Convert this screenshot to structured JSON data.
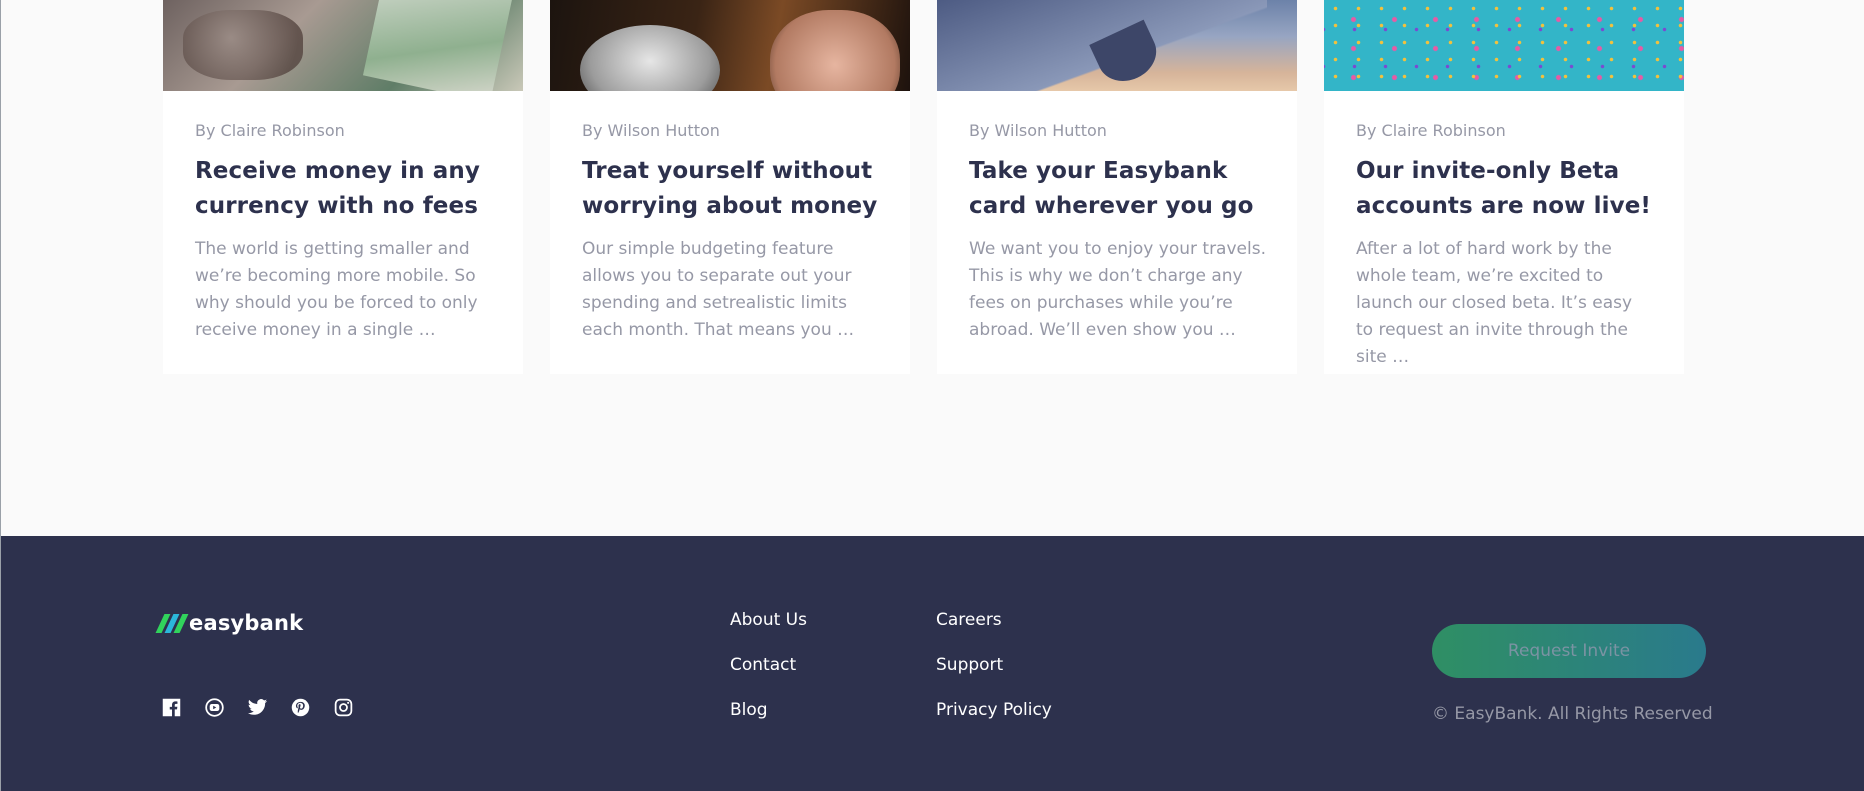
{
  "articles": [
    {
      "author": "By Claire Robinson",
      "title": "Receive money in any currency with no fees",
      "excerpt": "The world is getting smaller and we’re becoming more mobile. So why should you be forced to only receive money in a single …",
      "image": "currency-notes"
    },
    {
      "author": "By Wilson Hutton",
      "title": "Treat yourself without worrying about money",
      "excerpt": "Our simple budgeting feature allows you to separate out your spending and setrealistic limits each month. That means you …",
      "image": "restaurant-dining"
    },
    {
      "author": "By Wilson Hutton",
      "title": "Take your Easybank card wherever you go",
      "excerpt": "We want you to enjoy your travels. This is why we don’t charge any fees on purchases while you’re abroad. We’ll even show you …",
      "image": "airplane-wing"
    },
    {
      "author": "By Claire Robinson",
      "title": "Our invite-only Beta accounts are now live!",
      "excerpt": "After a lot of hard work by the whole team, we’re excited to launch our closed beta. It’s easy to request an invite through the site …",
      "image": "confetti"
    }
  ],
  "footer": {
    "logo_text": "easybank",
    "socials": [
      "facebook-icon",
      "youtube-icon",
      "twitter-icon",
      "pinterest-icon",
      "instagram-icon"
    ],
    "links_col1": [
      "About Us",
      "Contact",
      "Blog"
    ],
    "links_col2": [
      "Careers",
      "Support",
      "Privacy Policy"
    ],
    "cta_label": "Request Invite",
    "copyright": "© EasyBank. All Rights Reserved"
  },
  "colors": {
    "footer_bg": "#2d314d",
    "brand_green": "#31d35c",
    "brand_cyan": "#2bb7da",
    "text_dark": "#2d314d",
    "text_gray": "#9698a6"
  }
}
